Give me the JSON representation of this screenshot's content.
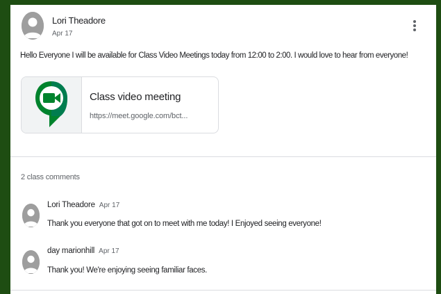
{
  "post": {
    "author": "Lori Theadore",
    "date": "Apr 17",
    "message": "Hello Everyone I will be available for Class Video Meetings today from 12:00 to 2:00. I would love to hear from everyone!",
    "more_icon": "more-vert-icon"
  },
  "attachment": {
    "title": "Class video meeting",
    "url": "https://meet.google.com/bct...",
    "icon": "google-meet-icon"
  },
  "comments_section": {
    "count_label": "2 class comments",
    "comments": [
      {
        "author": "Lori Theadore",
        "date": "Apr 17",
        "text": "Thank you everyone that got on to meet with me today! I Enjoyed seeing everyone!"
      },
      {
        "author": "day marionhill",
        "date": "Apr 17",
        "text": "Thank you! We're enjoying seeing familiar faces."
      }
    ]
  },
  "colors": {
    "page_background": "#1e4d12",
    "card_background": "#ffffff",
    "avatar_gray": "#9e9e9e",
    "meet_green": "#00832d",
    "meet_teal": "#00796b"
  }
}
